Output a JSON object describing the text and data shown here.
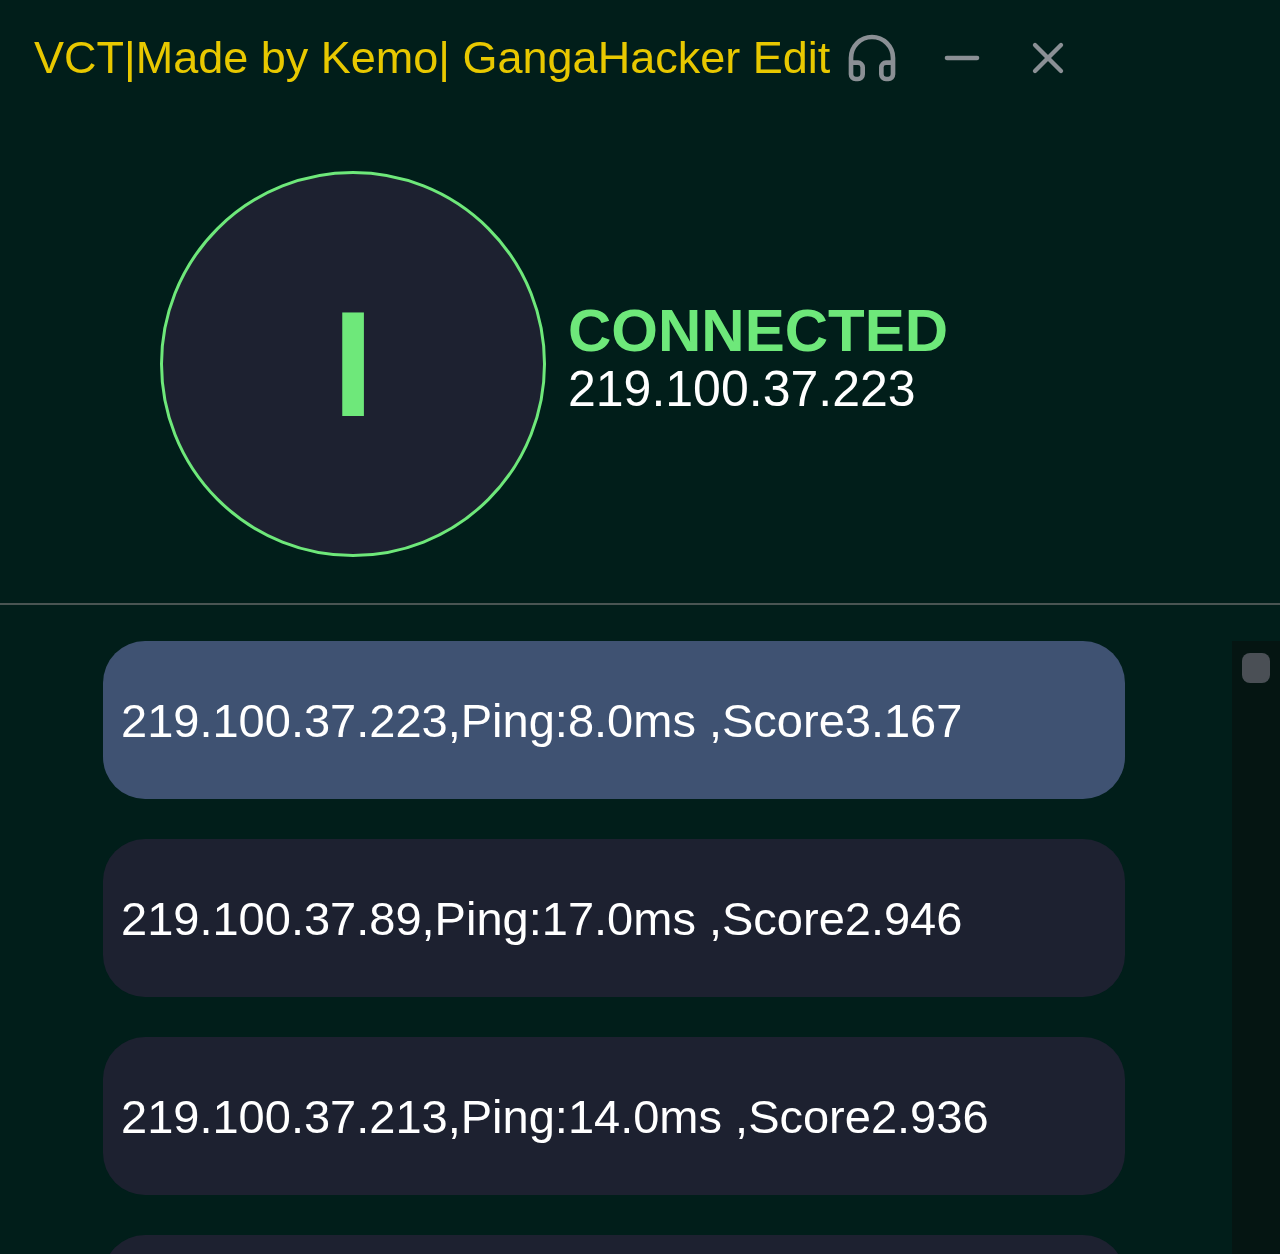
{
  "window": {
    "title": "VCT|Made by Kemo| GangaHacker Edit"
  },
  "status": {
    "toggle_glyph": "I",
    "state": "CONNECTED",
    "connected": true,
    "address": "219.100.37.223"
  },
  "servers": [
    {
      "label": "219.100.37.223,Ping:8.0ms ,Score3.167",
      "selected": true
    },
    {
      "label": "219.100.37.89,Ping:17.0ms ,Score2.946",
      "selected": false
    },
    {
      "label": "219.100.37.213,Ping:14.0ms ,Score2.936",
      "selected": false
    },
    {
      "selected": false
    }
  ]
}
